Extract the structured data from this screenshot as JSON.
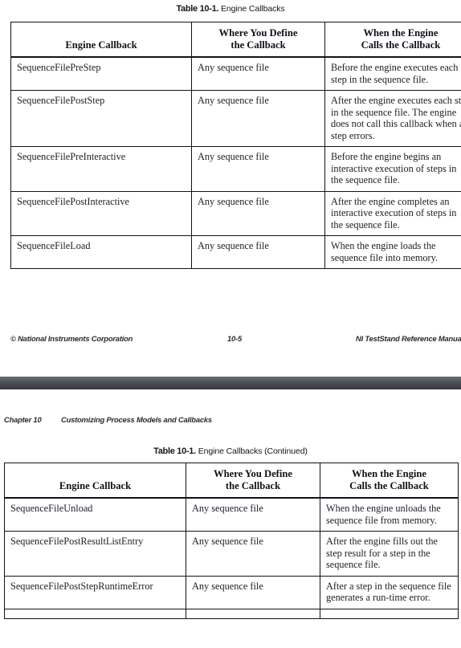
{
  "document": {
    "table_caption_label": "Table 10-1.",
    "table_caption_text": "Engine Callbacks",
    "table_caption_text_continued": "Engine Callbacks (Continued)",
    "columns": [
      "Engine Callback",
      "Where You Define\nthe Callback",
      "When the Engine\nCalls the Callback"
    ],
    "column_headers": {
      "engine_callback": "Engine Callback",
      "where_define_line1": "Where You Define",
      "where_define_line2": "the Callback",
      "when_calls_line1": "When the Engine",
      "when_calls_line2": "Calls the Callback"
    }
  },
  "page_one": {
    "rows": [
      {
        "callback": "SequenceFilePreStep",
        "where": "Any sequence file",
        "when": "Before the engine executes each step in the sequence file."
      },
      {
        "callback": "SequenceFilePostStep",
        "where": "Any sequence file",
        "when": "After the engine executes each step in the sequence file. The engine does not call this callback when a step errors."
      },
      {
        "callback": "SequenceFilePreInteractive",
        "where": "Any sequence file",
        "when": "Before the engine begins an interactive execution of steps in the sequence file."
      },
      {
        "callback": "SequenceFilePostInteractive",
        "where": "Any sequence file",
        "when": "After the engine completes an interactive execution of steps in the sequence file."
      },
      {
        "callback": "SequenceFileLoad",
        "where": "Any sequence file",
        "when": "When the engine loads the sequence file into memory."
      }
    ],
    "footer": {
      "copyright": "© National Instruments Corporation",
      "page_number": "10-5",
      "manual_title": "NI TestStand Reference Manual"
    }
  },
  "page_two": {
    "header": {
      "chapter": "Chapter 10",
      "title": "Customizing Process Models and Callbacks"
    },
    "rows": [
      {
        "callback": "SequenceFileUnload",
        "where": "Any sequence file",
        "when": "When the engine unloads the sequence file from memory."
      },
      {
        "callback": "SequenceFilePostResultListEntry",
        "where": "Any sequence file",
        "when": "After the engine fills out the step result for a step in the sequence file."
      },
      {
        "callback": "SequenceFilePostStepRuntimeError",
        "where": "Any sequence file",
        "when": "After a step in the sequence file generates a run-time error."
      },
      {
        "callback": "",
        "where": "",
        "when": ""
      }
    ]
  },
  "colors": {
    "page_background": "#ffffff",
    "text": "#20202a",
    "rule": "#12121a",
    "separator_band": "#4a4e54"
  }
}
